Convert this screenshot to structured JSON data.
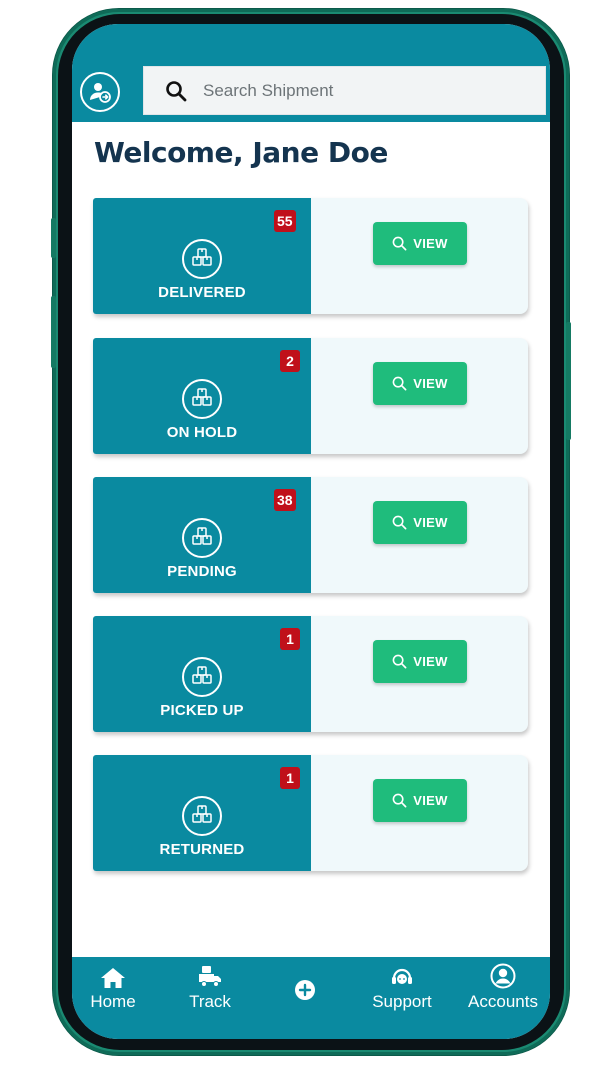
{
  "header": {
    "search_placeholder": "Search Shipment"
  },
  "welcome_text": "Welcome, Jane Doe",
  "cards": [
    {
      "label": "DELIVERED",
      "count": "55",
      "button": "VIEW"
    },
    {
      "label": "ON HOLD",
      "count": "2",
      "button": "VIEW"
    },
    {
      "label": "PENDING",
      "count": "38",
      "button": "VIEW"
    },
    {
      "label": "PICKED UP",
      "count": "1",
      "button": "VIEW"
    },
    {
      "label": "RETURNED",
      "count": "1",
      "button": "VIEW"
    }
  ],
  "nav": {
    "home": "Home",
    "track": "Track",
    "support": "Support",
    "accounts": "Accounts"
  },
  "colors": {
    "primary": "#0a8aa0",
    "card_bg": "#f0f9fb",
    "view_button": "#1fbc7c",
    "badge": "#c0101a",
    "heading": "#14344f",
    "frame": "#1a8a72"
  },
  "icons": {
    "profile": "user-logout-icon",
    "search": "search-icon",
    "status": "boxes-icon",
    "view": "magnifier-icon",
    "home": "home-icon",
    "track": "delivery-truck-icon",
    "add": "plus-circle-icon",
    "support": "headset-icon",
    "accounts": "user-circle-icon"
  }
}
